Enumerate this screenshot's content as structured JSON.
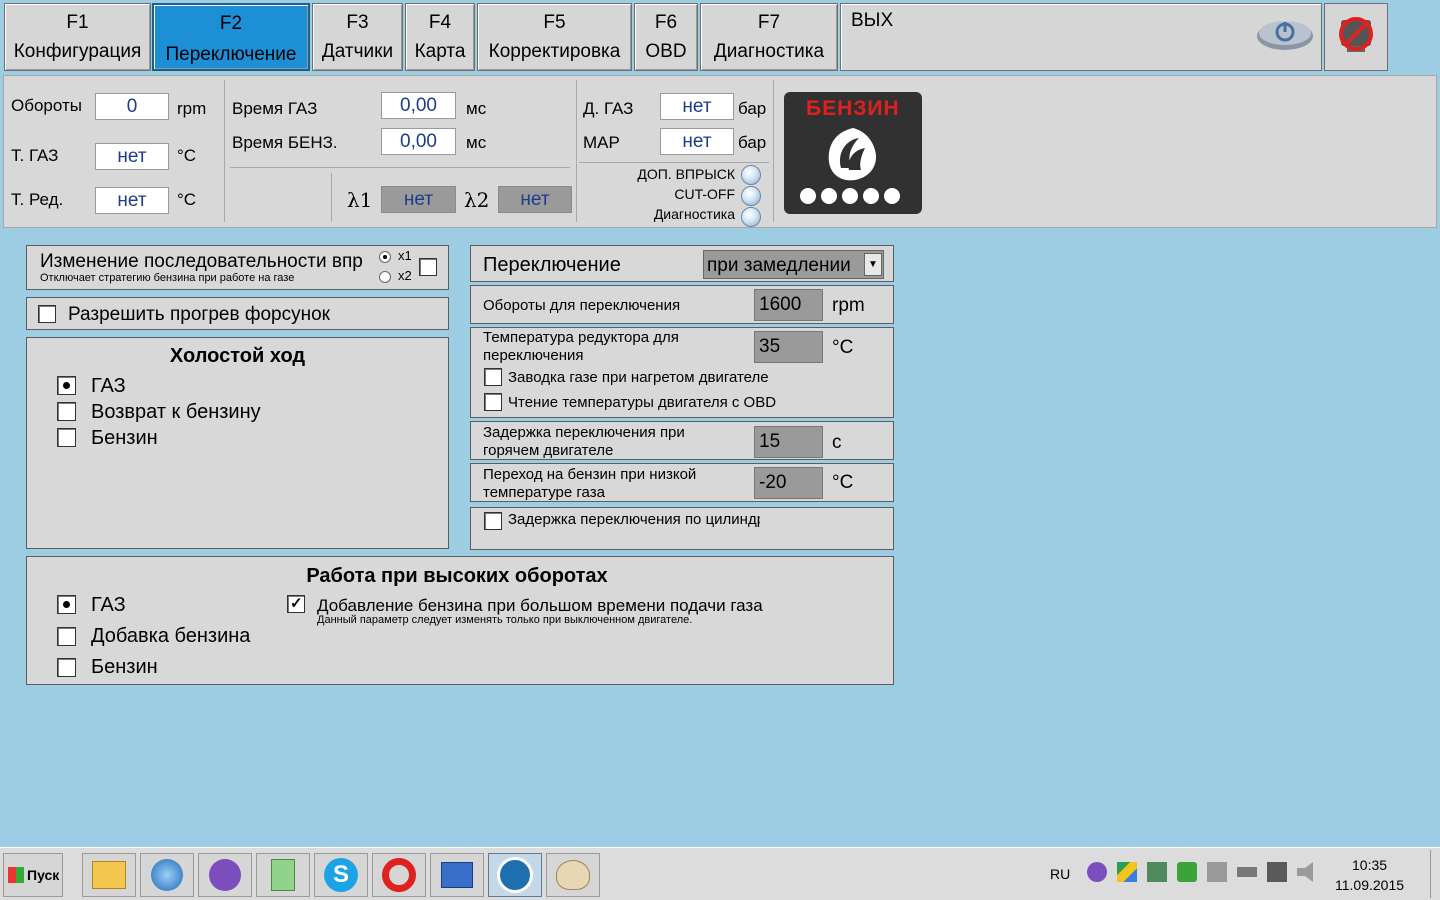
{
  "tabs": [
    {
      "key": "F1",
      "name": "Конфигурация"
    },
    {
      "key": "F2",
      "name": "Переключение"
    },
    {
      "key": "F3",
      "name": "Датчики"
    },
    {
      "key": "F4",
      "name": "Карта"
    },
    {
      "key": "F5",
      "name": "Корректировка"
    },
    {
      "key": "F6",
      "name": "OBD"
    },
    {
      "key": "F7",
      "name": "Диагностика"
    }
  ],
  "exit_label": "ВЫХ",
  "status": {
    "rpm_label": "Обороты",
    "rpm_value": "0",
    "rpm_unit": "rpm",
    "tgas_label": "Т. ГАЗ",
    "tgas_value": "нет",
    "tgas_unit": "°C",
    "tred_label": "Т. Ред.",
    "tred_value": "нет",
    "tred_unit": "°C",
    "time_gas_label": "Время ГАЗ",
    "time_gas_value": "0,00",
    "time_gas_unit": "мс",
    "time_benz_label": "Время БЕНЗ.",
    "time_benz_value": "0,00",
    "time_benz_unit": "мс",
    "lambda1_label": "λ1",
    "lambda1_value": "нет",
    "lambda2_label": "λ2",
    "lambda2_value": "нет",
    "dgas_label": "Д. ГАЗ",
    "dgas_value": "нет",
    "dgas_unit": "бар",
    "map_label": "MAP",
    "map_value": "нет",
    "map_unit": "бар",
    "led1_label": "ДОП. ВПРЫСК",
    "led2_label": "CUT-OFF",
    "led3_label": "Диагностика",
    "fuel_badge": "БЕНЗИН"
  },
  "sequence": {
    "title": "Изменение последовательности впр",
    "subtitle": "Отключает стратегию бензина при работе на газе",
    "x1": "x1",
    "x2": "x2"
  },
  "warmup_label": "Разрешить прогрев форсунок",
  "idle": {
    "title": "Холостой ход",
    "options": [
      "ГАЗ",
      "Возврат к бензину",
      "Бензин"
    ]
  },
  "high_rpm": {
    "title": "Работа при высоких оборотах",
    "options": [
      "ГАЗ",
      "Добавка бензина",
      "Бензин"
    ],
    "check_label": "Добавление бензина при большом времени подачи газа",
    "check_note": "Данный параметр следует изменять только при выключенном двигателе."
  },
  "switching": {
    "label": "Переключение",
    "select_value": "при замедлении",
    "rpm_label": "Обороты для переключения",
    "rpm_value": "1600",
    "rpm_unit": "rpm",
    "temp_label": "Температура редуктора для переключения",
    "temp_value": "35",
    "temp_unit": "°C",
    "hot_start_label": "Заводка газе при нагретом двигателе",
    "obd_temp_label": "Чтение температуры двигателя с OBD",
    "delay_label": "Задержка переключения при горячем двигателе",
    "delay_value": "15",
    "delay_unit": "с",
    "lowtemp_label": "Переход на бензин при низкой температуре газа",
    "lowtemp_value": "-20",
    "lowtemp_unit": "°C",
    "cyl_delay_label": "Задержка переключения по цилиндр"
  },
  "taskbar": {
    "start": "Пуск",
    "lang": "RU",
    "time": "10:35",
    "date": "11.09.2015"
  },
  "colors": {
    "active_tab": "#1d8fd6",
    "background": "#9ccde2",
    "badge_red": "#e02020"
  }
}
